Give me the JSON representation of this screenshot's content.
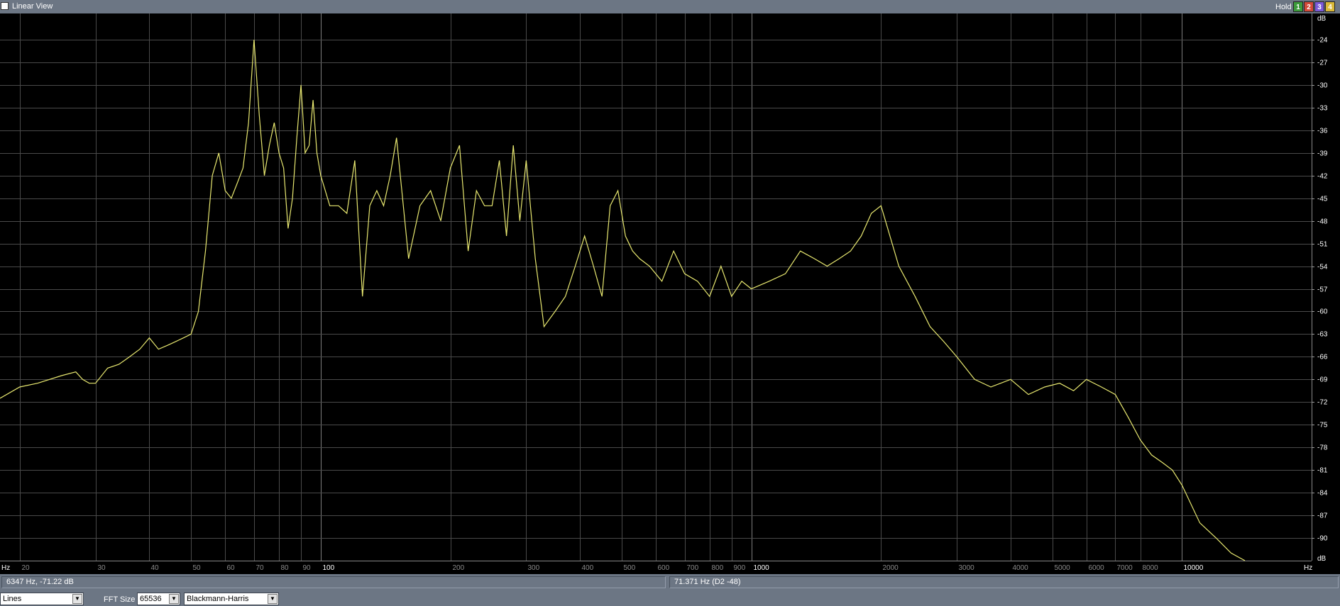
{
  "titlebar": {
    "view_label": "Linear View",
    "hold_label": "Hold",
    "hold_buttons": [
      {
        "label": "1",
        "color": "#3c9a3c"
      },
      {
        "label": "2",
        "color": "#d24a3a"
      },
      {
        "label": "3",
        "color": "#7a5ad8"
      },
      {
        "label": "4",
        "color": "#d8b838"
      }
    ]
  },
  "chart_data": {
    "type": "line",
    "xlabel": "Hz",
    "ylabel": "dB",
    "x_scale": "log",
    "xlim": [
      18,
      20000
    ],
    "ylim": [
      -93,
      -21
    ],
    "grid": true,
    "series_color": "#e8e870",
    "x_tick_labels": [
      {
        "value": 20,
        "label": "20"
      },
      {
        "value": 30,
        "label": "30"
      },
      {
        "value": 40,
        "label": "40"
      },
      {
        "value": 50,
        "label": "50"
      },
      {
        "value": 60,
        "label": "60"
      },
      {
        "value": 70,
        "label": "70"
      },
      {
        "value": 80,
        "label": "80"
      },
      {
        "value": 90,
        "label": "90"
      },
      {
        "value": 100,
        "label": "100"
      },
      {
        "value": 200,
        "label": "200"
      },
      {
        "value": 300,
        "label": "300"
      },
      {
        "value": 400,
        "label": "400"
      },
      {
        "value": 500,
        "label": "500"
      },
      {
        "value": 600,
        "label": "600"
      },
      {
        "value": 700,
        "label": "700"
      },
      {
        "value": 800,
        "label": "800"
      },
      {
        "value": 900,
        "label": "900"
      },
      {
        "value": 1000,
        "label": "1000"
      },
      {
        "value": 2000,
        "label": "2000"
      },
      {
        "value": 3000,
        "label": "3000"
      },
      {
        "value": 4000,
        "label": "4000"
      },
      {
        "value": 5000,
        "label": "5000"
      },
      {
        "value": 6000,
        "label": "6000"
      },
      {
        "value": 7000,
        "label": "7000"
      },
      {
        "value": 8000,
        "label": "8000"
      },
      {
        "value": 10000,
        "label": "10000"
      }
    ],
    "y_ticks": [
      -24,
      -27,
      -30,
      -33,
      -36,
      -39,
      -42,
      -45,
      -48,
      -51,
      -54,
      -57,
      -60,
      -63,
      -66,
      -69,
      -72,
      -75,
      -78,
      -81,
      -84,
      -87,
      -90
    ],
    "series": [
      {
        "x": [
          18,
          20,
          22,
          25,
          27,
          28,
          29,
          30,
          32,
          34,
          36,
          38,
          40,
          42,
          44,
          46,
          48,
          50,
          52,
          54,
          56,
          58,
          60,
          62,
          64,
          66,
          68,
          70,
          72,
          74,
          76,
          78,
          80,
          82,
          84,
          86,
          88,
          90,
          92,
          94,
          96,
          98,
          100,
          105,
          110,
          115,
          120,
          125,
          130,
          135,
          140,
          145,
          150,
          160,
          170,
          180,
          190,
          200,
          210,
          220,
          230,
          240,
          250,
          260,
          270,
          280,
          290,
          300,
          315,
          330,
          350,
          370,
          390,
          410,
          430,
          450,
          470,
          490,
          510,
          530,
          550,
          580,
          620,
          660,
          700,
          750,
          800,
          850,
          900,
          950,
          1000,
          1100,
          1200,
          1300,
          1400,
          1500,
          1600,
          1700,
          1800,
          1900,
          2000,
          2200,
          2400,
          2600,
          2800,
          3000,
          3300,
          3600,
          4000,
          4400,
          4800,
          5200,
          5600,
          6000,
          6500,
          7000,
          7500,
          8000,
          8500,
          9000,
          9500,
          10000,
          11000,
          12000,
          13000,
          14000
        ],
        "y": [
          -71.5,
          -70,
          -69.5,
          -68.5,
          -68,
          -69,
          -69.5,
          -69.5,
          -67.5,
          -67,
          -66,
          -65,
          -63.5,
          -65,
          -64.5,
          -64,
          -63.5,
          -63,
          -60,
          -52,
          -42,
          -39,
          -44,
          -45,
          -43,
          -41,
          -35,
          -24,
          -34,
          -42,
          -38,
          -35,
          -39,
          -41,
          -49,
          -45,
          -37,
          -30,
          -39,
          -38,
          -32,
          -39,
          -42,
          -46,
          -46,
          -47,
          -40,
          -58,
          -46,
          -44,
          -46,
          -42,
          -37,
          -53,
          -46,
          -44,
          -48,
          -41,
          -38,
          -52,
          -44,
          -46,
          -46,
          -40,
          -50,
          -38,
          -48,
          -40,
          -53,
          -62,
          -60,
          -58,
          -54,
          -50,
          -54,
          -58,
          -46,
          -44,
          -50,
          -52,
          -53,
          -54,
          -56,
          -52,
          -55,
          -56,
          -58,
          -54,
          -58,
          -56,
          -57,
          -56,
          -55,
          -52,
          -53,
          -54,
          -53,
          -52,
          -50,
          -47,
          -46,
          -54,
          -58,
          -62,
          -64,
          -66,
          -69,
          -70,
          -69,
          -71,
          -70,
          -69.5,
          -70.5,
          -69,
          -70,
          -71,
          -74,
          -77,
          -79,
          -80,
          -81,
          -83,
          -88,
          -90,
          -92,
          -93
        ]
      }
    ]
  },
  "status": {
    "cursor_readout": "6347 Hz, -71.22 dB",
    "peak_readout": "71.371 Hz (D2 -48)"
  },
  "controls": {
    "display_mode": "Lines",
    "fft_size_label": "FFT Size",
    "fft_size_value": "65536",
    "window_value": "Blackmann-Harris"
  }
}
